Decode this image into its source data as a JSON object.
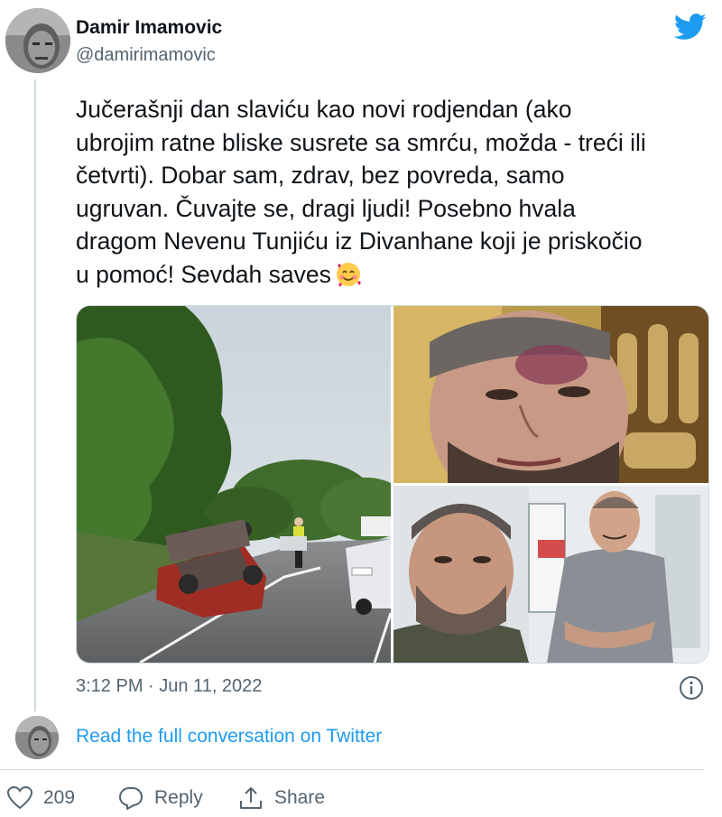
{
  "tweet": {
    "author_name": "Damir Imamovic",
    "author_handle": "@damirimamovic",
    "text": "Jučerašnji dan slaviću kao novi rodjendan (ako ubrojim ratne bliske susrete sa smrću, možda - treći ili četvrti). Dobar sam, zdrav, bez povreda, samo ugruvan. Čuvajte se, dragi ljudi! Posebno hvala dragom Nevenu Tunjiću iz Divanhane koji je priskočio u pomoć! Sevdah saves",
    "emoji": "smiling-face-with-hearts",
    "timestamp": "3:12 PM · Jun 11, 2022",
    "media": [
      {
        "name": "overturned-car-road-photo"
      },
      {
        "name": "bruised-face-selfie-photo"
      },
      {
        "name": "two-men-selfie-photo"
      }
    ]
  },
  "conversation": {
    "link_text": "Read the full conversation on Twitter"
  },
  "actions": {
    "like_count": "209",
    "reply_label": "Reply",
    "share_label": "Share"
  },
  "colors": {
    "twitter_blue": "#1d9bf0",
    "text_primary": "#0f1419",
    "text_secondary": "#536471",
    "border": "#cfd9de"
  },
  "icons": [
    "twitter-bird-icon",
    "info-icon",
    "heart-icon",
    "reply-icon",
    "share-icon"
  ]
}
